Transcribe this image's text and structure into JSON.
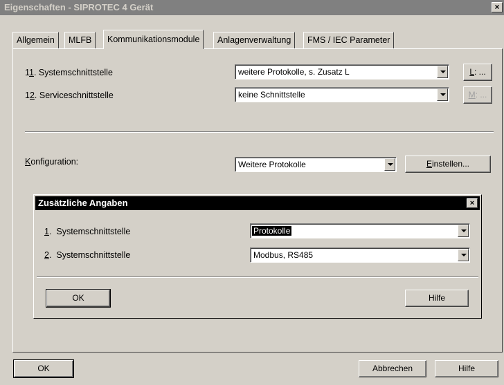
{
  "window": {
    "title": "Eigenschaften - SIPROTEC 4 Gerät",
    "close": "×"
  },
  "tabs": [
    {
      "label": "Allgemein"
    },
    {
      "label": "MLFB"
    },
    {
      "label": "Kommunikationsmodule",
      "active": true
    },
    {
      "label": "Anlagenverwaltung"
    },
    {
      "label": "FMS / IEC Parameter"
    }
  ],
  "interfaces": [
    {
      "num": "11",
      "num_hotkey": "1",
      "num_rest": ". Systemschnittstelle",
      "num_prefix": "1",
      "value": "weitere Protokolle, s. Zusatz L",
      "button": {
        "hotkey": "L",
        "rest": ": ..."
      }
    },
    {
      "num": "12",
      "num_prefix": "1",
      "num_hotkey": "2",
      "num_rest": ". Serviceschnittstelle",
      "value": "keine Schnittstelle",
      "button": {
        "hotkey": "M",
        "rest": ": ...",
        "disabled": true
      }
    }
  ],
  "config": {
    "label_hotkey": "K",
    "label_rest": "onfiguration:",
    "value": "Weitere Protokolle",
    "button_hotkey": "E",
    "button_rest": "instellen..."
  },
  "subdialog": {
    "title": "Zusätzliche Angaben",
    "close": "×",
    "rows": [
      {
        "hotkey": "1",
        "label": ".  Systemschnittstelle",
        "value": "Protokolle",
        "selected": true
      },
      {
        "hotkey": "2",
        "label": ".  Systemschnittstelle",
        "value": "Modbus, RS485"
      }
    ],
    "ok": "OK",
    "help": "Hilfe"
  },
  "footer": {
    "ok": "OK",
    "cancel": "Abbrechen",
    "help": "Hilfe"
  }
}
